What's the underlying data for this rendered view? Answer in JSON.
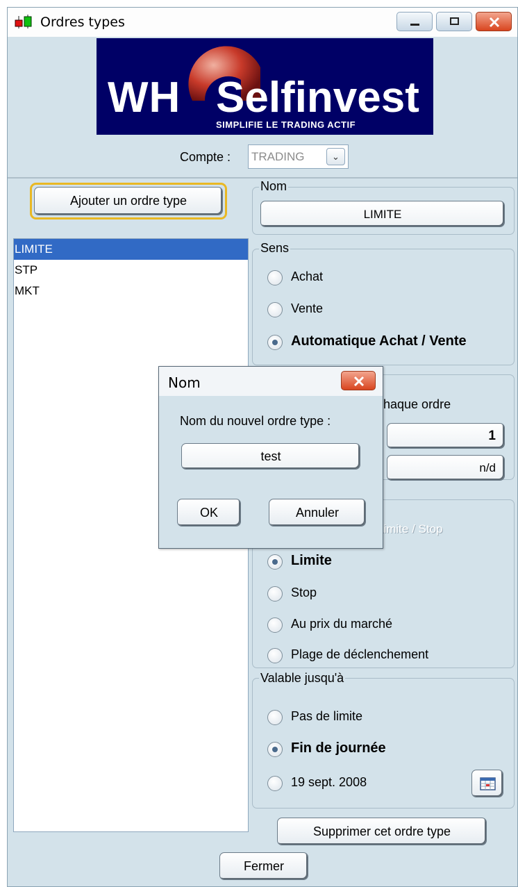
{
  "window": {
    "title": "Ordres types",
    "app_icon": "candlestick-chart-icon",
    "controls": [
      "minimize-icon",
      "restore-icon",
      "close-icon"
    ]
  },
  "logo": {
    "text_left": "WH",
    "text_right": "Selfinvest",
    "tagline": "SIMPLIFIE LE TRADING ACTIF",
    "background_color": "#000066"
  },
  "account": {
    "label": "Compte :",
    "value": "TRADING"
  },
  "add_button": {
    "label": "Ajouter un ordre type"
  },
  "order_list": {
    "items": [
      {
        "label": "LIMITE",
        "selected": true
      },
      {
        "label": "STP",
        "selected": false
      },
      {
        "label": "MKT",
        "selected": false
      }
    ]
  },
  "name_group": {
    "legend": "Nom",
    "value": "LIMITE"
  },
  "direction_group": {
    "legend": "Sens",
    "options": [
      {
        "label": "Achat",
        "selected": false
      },
      {
        "label": "Vente",
        "selected": false
      },
      {
        "label": "Automatique Achat / Vente",
        "selected": true
      }
    ]
  },
  "quantity_group": {
    "legend_partial": "chaque ordre",
    "quantity_value": "1",
    "secondary_value": "n/d"
  },
  "type_group": {
    "legend_partial": "Limite / Stop",
    "options": [
      {
        "label": "Limite",
        "selected": true
      },
      {
        "label": "Stop",
        "selected": false
      },
      {
        "label": "Au prix du marché",
        "selected": false
      },
      {
        "label": "Plage de déclenchement",
        "selected": false
      }
    ]
  },
  "validity_group": {
    "legend": "Valable jusqu'à",
    "options": [
      {
        "label": "Pas de limite",
        "selected": false
      },
      {
        "label": "Fin de journée",
        "selected": true
      },
      {
        "label": "19 sept. 2008",
        "selected": false
      }
    ],
    "calendar_icon": "calendar-icon"
  },
  "delete_button": {
    "label": "Supprimer cet ordre type"
  },
  "close_button": {
    "label": "Fermer"
  },
  "dialog": {
    "title": "Nom",
    "prompt": "Nom du nouvel ordre type :",
    "input_value": "test",
    "ok_label": "OK",
    "cancel_label": "Annuler"
  },
  "colors": {
    "panel": "#d3e2ea",
    "selection": "#316ac5",
    "focus_ring": "#e9b824",
    "close_button": "#d9451f"
  }
}
